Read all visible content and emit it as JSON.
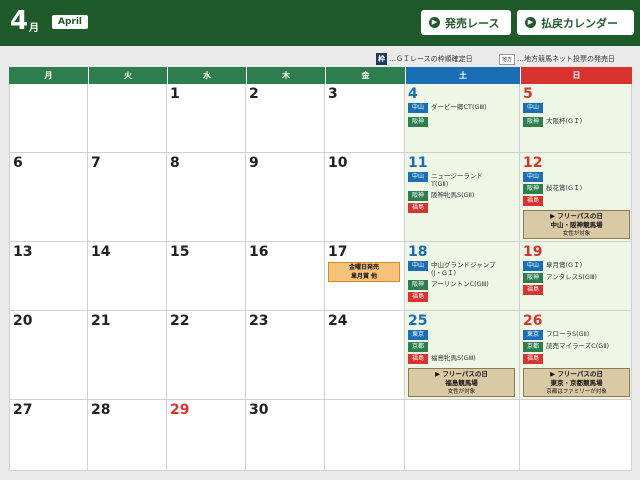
{
  "header": {
    "month_number": "4",
    "month_suffix": "月",
    "month_english": "April",
    "btn_race": "発売レース",
    "btn_payout": "払戻カレンダー"
  },
  "legend": {
    "waku_icon": "枠",
    "waku_text": "…ＧＩレースの枠順確定日",
    "chiho_icon": "地方",
    "chiho_text": "…地方競馬ネット投票の発売日"
  },
  "weekdays": [
    "月",
    "火",
    "水",
    "木",
    "金",
    "土",
    "日"
  ],
  "days": {
    "d1": "1",
    "d2": "2",
    "d3": "3",
    "d4": "4",
    "d5": "5",
    "d6": "6",
    "d7": "7",
    "d8": "8",
    "d9": "9",
    "d10": "10",
    "d11": "11",
    "d12": "12",
    "d13": "13",
    "d14": "14",
    "d15": "15",
    "d16": "16",
    "d17": "17",
    "d18": "18",
    "d19": "19",
    "d20": "20",
    "d21": "21",
    "d22": "22",
    "d23": "23",
    "d24": "24",
    "d25": "25",
    "d26": "26",
    "d27": "27",
    "d28": "28",
    "d29": "29",
    "d30": "30"
  },
  "tracks": {
    "nakayama": "中山",
    "hanshin": "阪神",
    "fukushima": "福島",
    "tokyo": "東京",
    "kyoto": "京都"
  },
  "races": {
    "r4a": "ダービー卿CT(GⅢ)",
    "r5b": "大阪杯(GＩ)",
    "r11a_1": "ニュージーランド",
    "r11a_2": "T(GⅡ)",
    "r11b": "阪神牝馬S(GⅡ)",
    "r12b": "桜花賞(GＩ)",
    "r18a_1": "中山グランドジャンプ",
    "r18a_2": "(J・GＩ)",
    "r18b": "アーリントンC(GⅢ)",
    "r19a": "皐月賞(GＩ)",
    "r19b": "アンタレスS(GⅢ)",
    "r25c": "福島牝馬S(GⅢ)",
    "r26a": "フローラS(GⅡ)",
    "r26b": "読売マイラーズC(GⅡ)"
  },
  "notices": {
    "n12_1": "▶ フリーパスの日",
    "n12_2": "中山・阪神競馬場",
    "n12_3": "女性が対象",
    "n25_1": "▶ フリーパスの日",
    "n25_2": "福島競馬場",
    "n25_3": "女性が対象",
    "n26_1": "▶ フリーパスの日",
    "n26_2": "東京・京都競馬場",
    "n26_3": "京都はファミリーが対象",
    "fri17_1": "金曜日発売",
    "fri17_2": "皐月賞 他"
  },
  "colors": {
    "header_bg": "#1f5a2a",
    "weekday_header": "#2e7d4f",
    "saturday": "#1a6fb4",
    "sunday": "#d8332f",
    "weekend_bg": "#eef7e6",
    "notice_bg": "#d9c9a4",
    "friday_notice_bg": "#f6c27a"
  }
}
